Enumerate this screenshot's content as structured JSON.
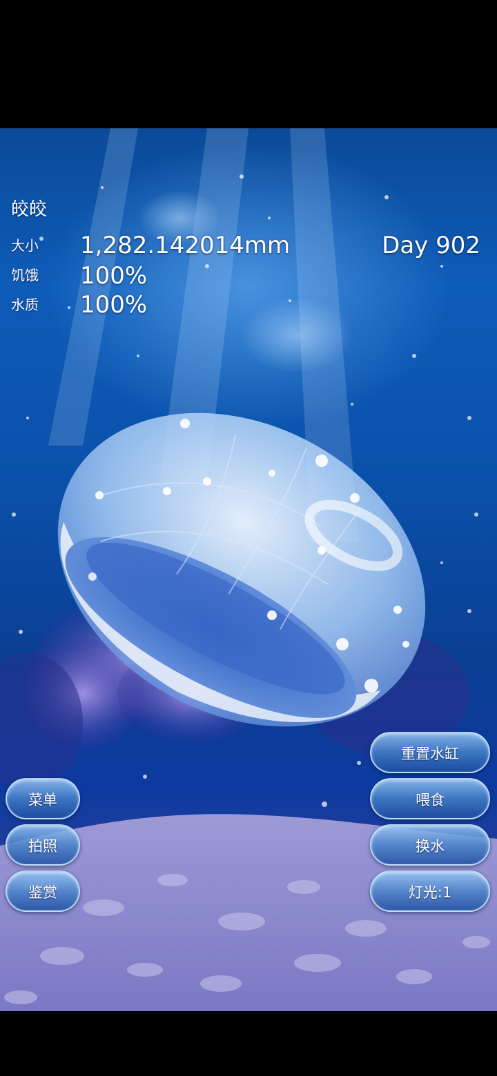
{
  "pet": {
    "name": "皎皎"
  },
  "stats": {
    "size_label": "大小",
    "size_value": "1,282.142014mm",
    "hunger_label": "饥饿",
    "hunger_value": "100%",
    "water_label": "水质",
    "water_value": "100%"
  },
  "day_counter": "Day 902",
  "left_buttons": {
    "menu": "菜单",
    "photo": "拍照",
    "gallery": "鉴赏"
  },
  "right_buttons": {
    "reset_tank": "重置水缸",
    "feed": "喂食",
    "change_water": "换水",
    "light": "灯光:1"
  },
  "colors": {
    "water_top": "#0b4a98",
    "water_mid": "#0a4fa8",
    "sand": "#8a86c8",
    "button_fill": "#4682c8",
    "button_border": "#c8e6ff"
  }
}
